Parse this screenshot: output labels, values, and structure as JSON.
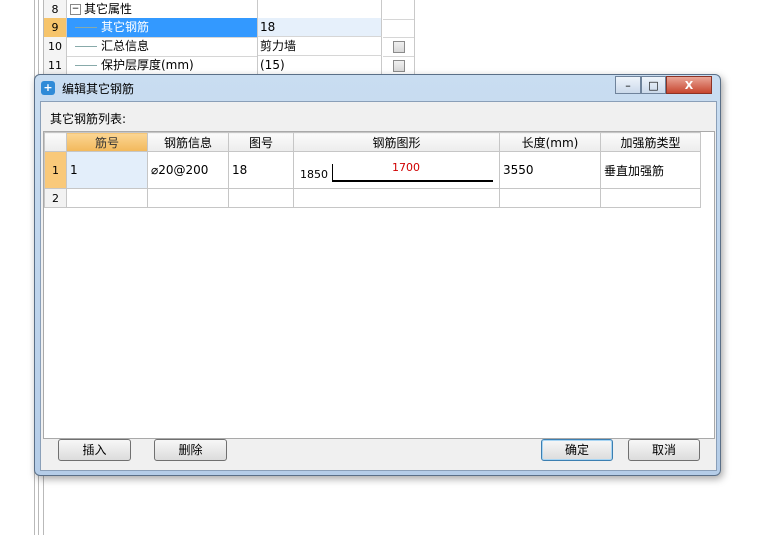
{
  "background_grid": {
    "rows": [
      {
        "num": "8",
        "name": "其它属性",
        "value": "",
        "checkbox": false,
        "group": true
      },
      {
        "num": "9",
        "name": "其它钢筋",
        "value": "18",
        "checkbox": false,
        "selected": true
      },
      {
        "num": "10",
        "name": "汇总信息",
        "value": "剪力墙",
        "checkbox": true
      },
      {
        "num": "11",
        "name": "保护层厚度(mm)",
        "value": "(15)",
        "checkbox": true
      }
    ]
  },
  "dialog": {
    "title": "编辑其它钢筋",
    "list_label": "其它钢筋列表:",
    "columns": [
      "筋号",
      "钢筋信息",
      "图号",
      "钢筋图形",
      "长度(mm)",
      "加强筋类型"
    ],
    "rows": [
      {
        "row_num": "1",
        "jin_hao": "1",
        "info": "⌀20@200",
        "tu_hao": "18",
        "shape_left": "1850",
        "shape_top": "1700",
        "length": "3550",
        "type": "垂直加强筋"
      },
      {
        "row_num": "2",
        "jin_hao": "",
        "info": "",
        "tu_hao": "",
        "shape_left": "",
        "shape_top": "",
        "length": "",
        "type": ""
      }
    ],
    "buttons": {
      "insert": "插入",
      "delete": "删除",
      "ok": "确定",
      "cancel": "取消"
    },
    "window_controls": {
      "minimize": "–",
      "maximize": "□",
      "close": "X"
    }
  }
}
